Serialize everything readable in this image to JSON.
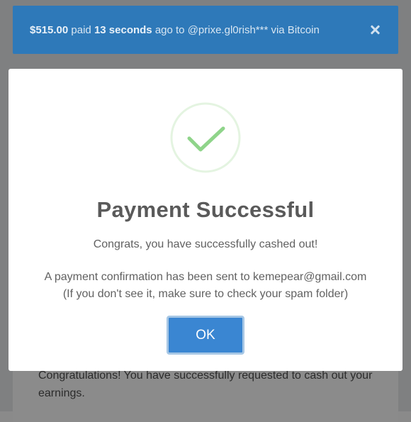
{
  "background_page": {
    "text": "Congratulations! You have successfully requested to cash out your earnings."
  },
  "notification": {
    "amount": "$515.00",
    "text_paid": " paid ",
    "time": "13 seconds",
    "text_rest": " ago to @prixe.gl0rish*** via Bitcoin",
    "close_icon": "close-icon",
    "color": "#2e79b9"
  },
  "modal": {
    "icon": "checkmark-circle-icon",
    "title": "Payment Successful",
    "subtitle": "Congrats, you have successfully cashed out!",
    "info_line1": "A payment confirmation has been sent to kemepear@gmail.com",
    "info_line2": "(If you don't see it, make sure to check your spam folder)",
    "ok_label": "OK",
    "accent_color": "#3a86d2",
    "success_color": "#8fd48a"
  }
}
